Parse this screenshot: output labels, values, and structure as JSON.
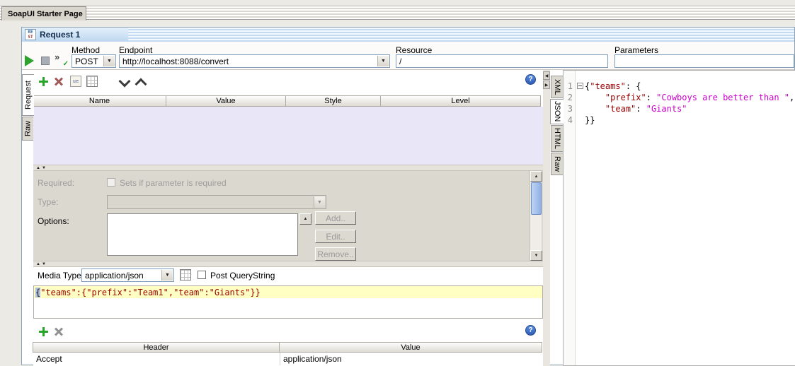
{
  "app": {
    "starter_tab_label": "SoapUI Starter Page"
  },
  "window": {
    "title": "Request 1",
    "icon_top": "RE",
    "icon_bottom": "ST"
  },
  "toolbar": {
    "method_label": "Method",
    "method_value": "POST",
    "endpoint_label": "Endpoint",
    "endpoint_value": "http://localhost:8088/convert",
    "resource_label": "Resource",
    "resource_value": "/",
    "parameters_label": "Parameters",
    "parameters_value": ""
  },
  "request_panel": {
    "tabs": [
      {
        "label": "Request"
      },
      {
        "label": "Raw"
      }
    ],
    "params_table": {
      "columns": [
        "Name",
        "Value",
        "Style",
        "Level"
      ]
    },
    "form": {
      "required_label": "Required:",
      "required_checkbox_text": "Sets if parameter is required",
      "type_label": "Type:",
      "type_value": "",
      "options_label": "Options:",
      "add_label": "Add..",
      "edit_label": "Edit..",
      "remove_label": "Remove.."
    },
    "media": {
      "label": "Media Type",
      "value": "application/json",
      "post_querystring_label": "Post QueryString"
    },
    "body": {
      "selected_char": "{",
      "rest": "\"teams\":{\"prefix\":\"Team1\",\"team\":\"Giants\"}}"
    },
    "headers_table": {
      "columns": [
        "Header",
        "Value"
      ],
      "rows": [
        {
          "header": "Accept",
          "value": "application/json"
        }
      ]
    }
  },
  "response_panel": {
    "tabs": [
      {
        "label": "XML"
      },
      {
        "label": "JSON"
      },
      {
        "label": "HTML"
      },
      {
        "label": "Raw"
      }
    ],
    "editor": {
      "lines": [
        {
          "num": "1",
          "fold": true,
          "segments": [
            {
              "t": "{",
              "c": "p"
            },
            {
              "t": "\"teams\"",
              "c": "k"
            },
            {
              "t": ": {",
              "c": "p"
            }
          ]
        },
        {
          "num": "2",
          "segments": [
            {
              "t": "    ",
              "c": "p"
            },
            {
              "t": "\"prefix\"",
              "c": "k"
            },
            {
              "t": ": ",
              "c": "p"
            },
            {
              "t": "\"Cowboys are better than \"",
              "c": "s"
            },
            {
              "t": ",",
              "c": "p"
            }
          ]
        },
        {
          "num": "3",
          "segments": [
            {
              "t": "    ",
              "c": "p"
            },
            {
              "t": "\"team\"",
              "c": "k"
            },
            {
              "t": ": ",
              "c": "p"
            },
            {
              "t": "\"Giants\"",
              "c": "s"
            }
          ]
        },
        {
          "num": "4",
          "segments": [
            {
              "t": "}}",
              "c": "p"
            }
          ]
        }
      ]
    }
  },
  "colors": {
    "accent_blue": "#bdd7ef",
    "help_blue": "#2e5cb8",
    "param_table_bg": "#e9e7f7",
    "body_highlight": "#ffffc4",
    "json_key": "#990000",
    "json_string": "#cc00cc"
  }
}
